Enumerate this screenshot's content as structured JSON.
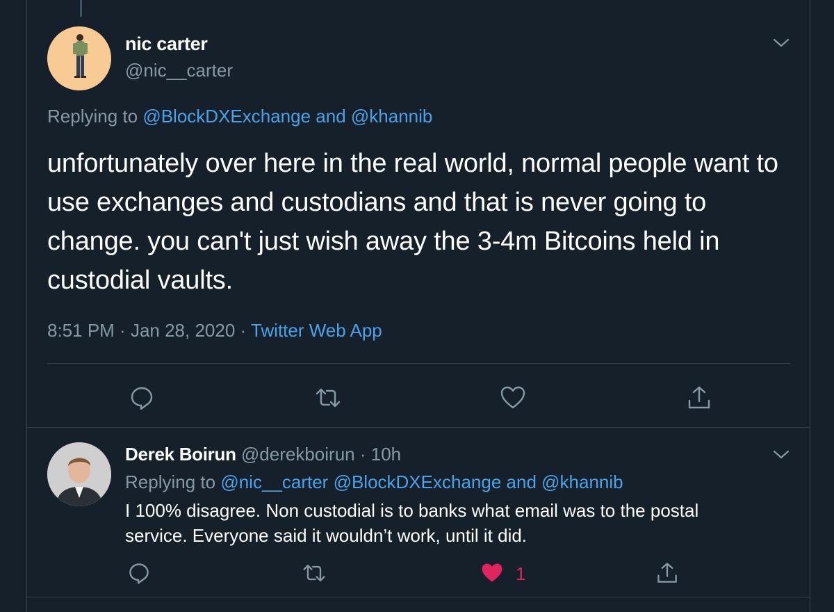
{
  "main_tweet": {
    "name": "nic carter",
    "handle": "@nic__carter",
    "replying_prefix": "Replying to ",
    "replying_to_1": "@BlockDXExchange",
    "replying_and": " and ",
    "replying_to_2": "@khannib",
    "text": "unfortunately over here in the real world, normal people want to use exchanges and custodians and that is never going to change. you can't just wish away the 3-4m Bitcoins held in custodial vaults.",
    "time": "8:51 PM",
    "sep1": " · ",
    "date": "Jan 28, 2020",
    "sep2": " · ",
    "source": "Twitter Web App",
    "icons": [
      "reply-icon",
      "retweet-icon",
      "like-icon",
      "share-icon"
    ]
  },
  "reply_tweet": {
    "name": "Derek Boirun",
    "handle": "@derekboirun",
    "dot": " · ",
    "time": "10h",
    "replying_prefix": "Replying to ",
    "replying_to_1": "@nic__carter",
    "replying_to_2": "@BlockDXExchange",
    "replying_and": " and ",
    "replying_to_3": "@khannib",
    "text_line1": "I 100% disagree.  Non custodial is to banks what email was to the postal",
    "text_line2": "service.  Everyone said it wouldn’t work, until it did.",
    "like_count": "1",
    "liked": true,
    "icons": [
      "reply-icon",
      "retweet-icon",
      "like-icon",
      "share-icon"
    ]
  },
  "colors": {
    "background": "#15202b",
    "secondary_text": "#8899a6",
    "link": "#4aa3e8",
    "like": "#e0245e",
    "border": "#38444d"
  }
}
